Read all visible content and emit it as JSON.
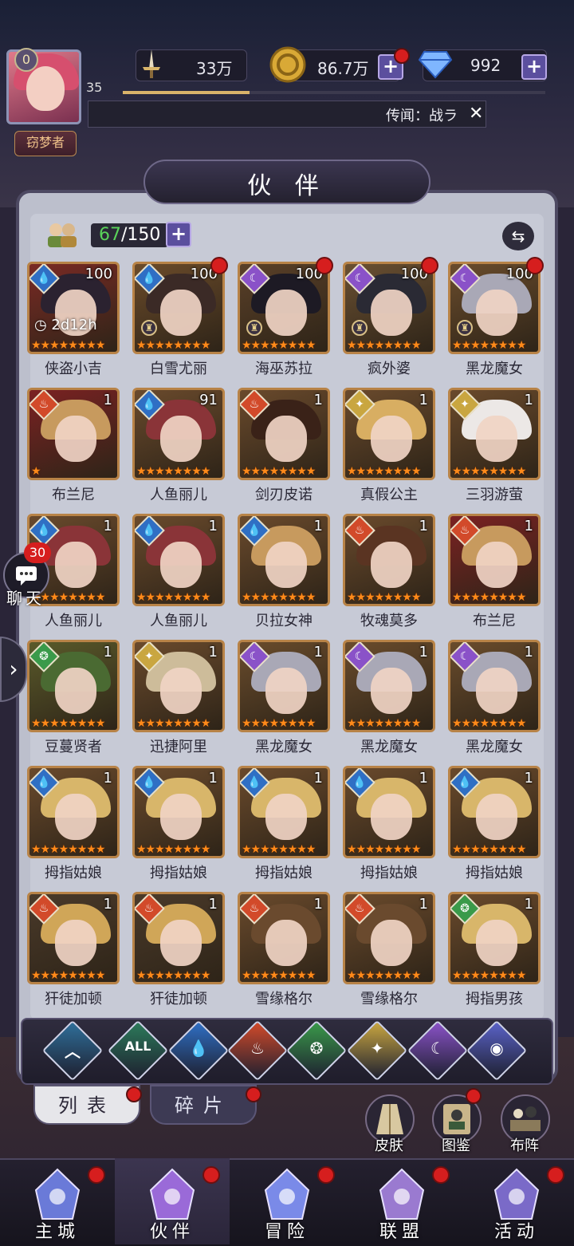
{
  "header": {
    "vip_level": "0",
    "player_level": "35",
    "player_title": "窃梦者",
    "power": "33万",
    "gold": "86.7万",
    "gems": "992",
    "exp_progress": 0.3,
    "rumor_text": "传闻：战ラ"
  },
  "panel": {
    "title": "伙 伴",
    "count_current": "67",
    "count_max": "/150"
  },
  "partners": [
    {
      "name": "侠盗小吉",
      "level": "100",
      "element": "water",
      "timer": "2d12h",
      "stars": "★★★★★★★★",
      "dot": false,
      "lock": false,
      "hair": "#2b2230",
      "bg": "#7a2a24"
    },
    {
      "name": "白雪尤丽",
      "level": "100",
      "element": "water",
      "stars": "★★★★★★★★",
      "dot": true,
      "lock": true,
      "hair": "#3b2a26",
      "bg": "#6b4b2a"
    },
    {
      "name": "海巫苏拉",
      "level": "100",
      "element": "dark",
      "stars": "★★★★★★★★",
      "dot": true,
      "lock": true,
      "hair": "#1d1a24",
      "bg": "#5a4028"
    },
    {
      "name": "疯外婆",
      "level": "100",
      "element": "dark",
      "stars": "★★★★★★★★",
      "dot": true,
      "lock": true,
      "hair": "#2a2a34",
      "bg": "#6a5032"
    },
    {
      "name": "黑龙魔女",
      "level": "100",
      "element": "dark",
      "stars": "★★★★★★★★",
      "dot": true,
      "lock": true,
      "hair": "#a9a8b6",
      "bg": "#6a4c2c"
    },
    {
      "name": "布兰尼",
      "level": "1",
      "element": "fire",
      "stars": "★",
      "dot": false,
      "lock": false,
      "hair": "#c79a5e",
      "bg": "#7b2222"
    },
    {
      "name": "人鱼丽儿",
      "level": "91",
      "element": "water",
      "stars": "★★★★★★★★",
      "dot": false,
      "lock": false,
      "hair": "#8a3438",
      "bg": "#6a4a2c"
    },
    {
      "name": "剑刃皮诺",
      "level": "1",
      "element": "fire",
      "stars": "★★★★★★★★",
      "dot": false,
      "lock": false,
      "hair": "#3a2218",
      "bg": "#6a4a2c"
    },
    {
      "name": "真假公主",
      "level": "1",
      "element": "light",
      "stars": "★★★★★★★★",
      "dot": false,
      "lock": false,
      "hair": "#d8ae62",
      "bg": "#6a4a2c"
    },
    {
      "name": "三羽游萤",
      "level": "1",
      "element": "light",
      "stars": "★★★★★★★★",
      "dot": false,
      "lock": false,
      "hair": "#ece8e6",
      "bg": "#6a4a2c"
    },
    {
      "name": "人鱼丽儿",
      "level": "1",
      "element": "water",
      "stars": "★★★★★★★★",
      "dot": false,
      "lock": false,
      "hair": "#8a3438",
      "bg": "#6a4a2c"
    },
    {
      "name": "人鱼丽儿",
      "level": "1",
      "element": "water",
      "stars": "★★★★★★★★",
      "dot": false,
      "lock": false,
      "hair": "#8a3438",
      "bg": "#6a4a2c"
    },
    {
      "name": "贝拉女神",
      "level": "1",
      "element": "water",
      "stars": "★★★★★★★★",
      "dot": false,
      "lock": false,
      "hair": "#c79a5e",
      "bg": "#6a4a2c"
    },
    {
      "name": "牧魂莫多",
      "level": "1",
      "element": "fire",
      "stars": "★★★★★★★★",
      "dot": false,
      "lock": false,
      "hair": "#5a3422",
      "bg": "#6a4a2c"
    },
    {
      "name": "布兰尼",
      "level": "1",
      "element": "fire",
      "stars": "★★★★★★★★",
      "dot": false,
      "lock": false,
      "hair": "#c79a5e",
      "bg": "#7b2222"
    },
    {
      "name": "豆蔓贤者",
      "level": "1",
      "element": "wind",
      "stars": "★★★★★★★★",
      "dot": false,
      "lock": false,
      "hair": "#4a6a32",
      "bg": "#5a5a2a"
    },
    {
      "name": "迅捷阿里",
      "level": "1",
      "element": "light",
      "stars": "★★★★★★★★",
      "dot": false,
      "lock": false,
      "hair": "#cdbc9a",
      "bg": "#6a4a2c"
    },
    {
      "name": "黑龙魔女",
      "level": "1",
      "element": "dark",
      "stars": "★★★★★★★★",
      "dot": false,
      "lock": false,
      "hair": "#a9a8b6",
      "bg": "#6a4c2c"
    },
    {
      "name": "黑龙魔女",
      "level": "1",
      "element": "dark",
      "stars": "★★★★★★★★",
      "dot": false,
      "lock": false,
      "hair": "#a9a8b6",
      "bg": "#6a4c2c"
    },
    {
      "name": "黑龙魔女",
      "level": "1",
      "element": "dark",
      "stars": "★★★★★★★★",
      "dot": false,
      "lock": false,
      "hair": "#a9a8b6",
      "bg": "#6a4c2c"
    },
    {
      "name": "拇指姑娘",
      "level": "1",
      "element": "water",
      "stars": "★★★★★★★★",
      "dot": false,
      "lock": false,
      "hair": "#d8b66a",
      "bg": "#6a4a2c"
    },
    {
      "name": "拇指姑娘",
      "level": "1",
      "element": "water",
      "stars": "★★★★★★★★",
      "dot": false,
      "lock": false,
      "hair": "#d8b66a",
      "bg": "#6a4a2c"
    },
    {
      "name": "拇指姑娘",
      "level": "1",
      "element": "water",
      "stars": "★★★★★★★★",
      "dot": false,
      "lock": false,
      "hair": "#d8b66a",
      "bg": "#6a4a2c"
    },
    {
      "name": "拇指姑娘",
      "level": "1",
      "element": "water",
      "stars": "★★★★★★★★",
      "dot": false,
      "lock": false,
      "hair": "#d8b66a",
      "bg": "#6a4a2c"
    },
    {
      "name": "拇指姑娘",
      "level": "1",
      "element": "water",
      "stars": "★★★★★★★★",
      "dot": false,
      "lock": false,
      "hair": "#d8b66a",
      "bg": "#6a4a2c"
    },
    {
      "name": "犴徒加顿",
      "level": "1",
      "element": "fire",
      "stars": "★★★★★★★★",
      "dot": false,
      "lock": false,
      "hair": "#d0a658",
      "bg": "#4a3a2a"
    },
    {
      "name": "犴徒加顿",
      "level": "1",
      "element": "fire",
      "stars": "★★★★★★★★",
      "dot": false,
      "lock": false,
      "hair": "#d0a658",
      "bg": "#4a3a2a"
    },
    {
      "name": "雪缘格尔",
      "level": "1",
      "element": "fire",
      "stars": "★★★★★★★★",
      "dot": false,
      "lock": false,
      "hair": "#6a4a2e",
      "bg": "#6a4a2c"
    },
    {
      "name": "雪缘格尔",
      "level": "1",
      "element": "fire",
      "stars": "★★★★★★★★",
      "dot": false,
      "lock": false,
      "hair": "#6a4a2e",
      "bg": "#6a4a2c"
    },
    {
      "name": "拇指男孩",
      "level": "1",
      "element": "wind",
      "stars": "★★★★★★★★",
      "dot": false,
      "lock": false,
      "hair": "#d8b66a",
      "bg": "#6a4a2c"
    }
  ],
  "element_colors": {
    "water": "#2f6fc4",
    "dark": "#8a52c8",
    "fire": "#d24a2a",
    "light": "#c9a640",
    "wind": "#3a9a4a"
  },
  "element_glyphs": {
    "water": "💧",
    "dark": "☾",
    "fire": "♨",
    "light": "✦",
    "wind": "❂"
  },
  "filters": [
    {
      "name": "filter-all-elements",
      "glyph": "︿",
      "color": "#2f6f9a"
    },
    {
      "name": "filter-all",
      "glyph": "ALL",
      "color": "#2c7a5a"
    },
    {
      "name": "filter-water",
      "glyph": "💧",
      "color": "#2f6fc4"
    },
    {
      "name": "filter-fire",
      "glyph": "♨",
      "color": "#d24a2a"
    },
    {
      "name": "filter-wind",
      "glyph": "❂",
      "color": "#3a9a4a"
    },
    {
      "name": "filter-light",
      "glyph": "✦",
      "color": "#c9a640"
    },
    {
      "name": "filter-dark",
      "glyph": "☾",
      "color": "#8a52c8"
    },
    {
      "name": "filter-cosmic",
      "glyph": "◉",
      "color": "#5a62c8"
    }
  ],
  "tabs": {
    "list": "列表",
    "fragments": "碎片"
  },
  "side_buttons": {
    "skins": "皮肤",
    "codex": "图鉴",
    "formation": "布阵"
  },
  "chat": {
    "count": "30",
    "label": "聊天"
  },
  "nav": [
    {
      "label": "主城",
      "icon": "castle-icon"
    },
    {
      "label": "伙伴",
      "icon": "witch-hat-icon"
    },
    {
      "label": "冒险",
      "icon": "compass-icon"
    },
    {
      "label": "联盟",
      "icon": "shield-icon"
    },
    {
      "label": "活动",
      "icon": "cards-icon"
    }
  ]
}
